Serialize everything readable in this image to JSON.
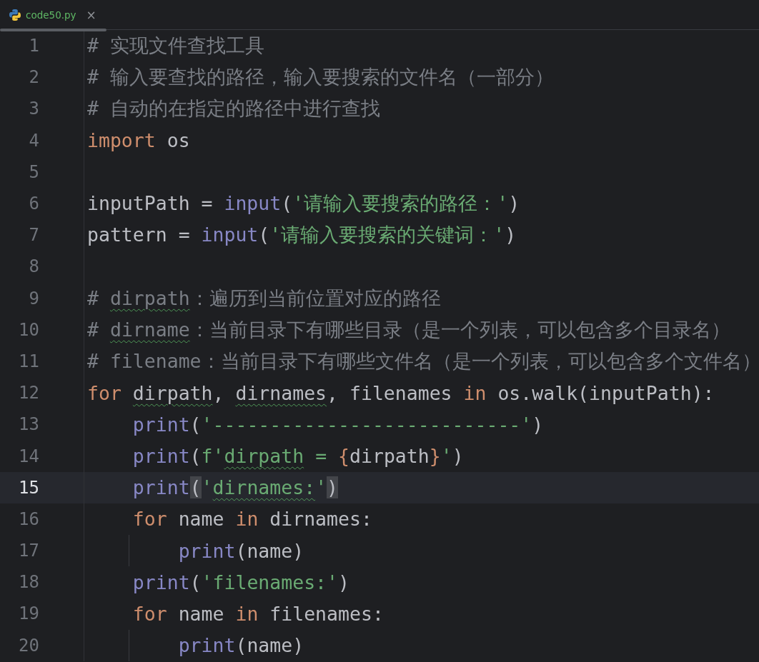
{
  "tab": {
    "label": "code50.py",
    "selected": true,
    "close": "×"
  },
  "lines": [
    {
      "number": "1",
      "current": false,
      "tokens": [
        {
          "kind": "comment",
          "text": "# 实现文件查找工具"
        }
      ]
    },
    {
      "number": "2",
      "current": false,
      "tokens": [
        {
          "kind": "comment",
          "text": "# 输入要查找的路径，输入要搜索的文件名（一部分）"
        }
      ]
    },
    {
      "number": "3",
      "current": false,
      "tokens": [
        {
          "kind": "comment",
          "text": "# 自动的在指定的路径中进行查找"
        }
      ]
    },
    {
      "number": "4",
      "current": false,
      "tokens": [
        {
          "kind": "keyword",
          "text": "import"
        },
        {
          "kind": "plain",
          "text": " os"
        }
      ]
    },
    {
      "number": "5",
      "current": false
    },
    {
      "number": "6",
      "current": false,
      "tokens": [
        {
          "kind": "plain",
          "text": "inputPath = "
        },
        {
          "kind": "builtin",
          "text": "input"
        },
        {
          "kind": "plain",
          "text": "("
        },
        {
          "kind": "string",
          "text": "'请输入要搜索的路径：'"
        },
        {
          "kind": "plain",
          "text": ")"
        }
      ]
    },
    {
      "number": "7",
      "current": false,
      "tokens": [
        {
          "kind": "plain",
          "text": "pattern = "
        },
        {
          "kind": "builtin",
          "text": "input"
        },
        {
          "kind": "plain",
          "text": "("
        },
        {
          "kind": "string",
          "text": "'请输入要搜索的关键词：'"
        },
        {
          "kind": "plain",
          "text": ")"
        }
      ]
    },
    {
      "number": "8",
      "current": false
    },
    {
      "number": "9",
      "current": false,
      "tokens": [
        {
          "kind": "comment",
          "text": "# "
        },
        {
          "kind": "comment-typo",
          "text": "dirpath"
        },
        {
          "kind": "comment",
          "text": "：遍历到当前位置对应的路径"
        }
      ]
    },
    {
      "number": "10",
      "current": false,
      "tokens": [
        {
          "kind": "comment",
          "text": "# "
        },
        {
          "kind": "comment-typo",
          "text": "dirname"
        },
        {
          "kind": "comment",
          "text": "：当前目录下有哪些目录（是一个列表，可以包含多个目录名）"
        }
      ]
    },
    {
      "number": "11",
      "current": false,
      "tokens": [
        {
          "kind": "comment",
          "text": "# filename：当前目录下有哪些文件名（是一个列表，可以包含多个文件名）"
        }
      ]
    },
    {
      "number": "12",
      "current": false,
      "tokens": [
        {
          "kind": "keyword",
          "text": "for "
        },
        {
          "kind": "plain-typo",
          "text": "dirpath"
        },
        {
          "kind": "plain",
          "text": ", "
        },
        {
          "kind": "plain-typo",
          "text": "dirnames"
        },
        {
          "kind": "plain",
          "text": ", filenames "
        },
        {
          "kind": "keyword",
          "text": "in"
        },
        {
          "kind": "plain",
          "text": " os.walk(inputPath):"
        }
      ]
    },
    {
      "number": "13",
      "current": false,
      "tokens": [
        {
          "kind": "builtin",
          "text": "    print"
        },
        {
          "kind": "plain",
          "text": "("
        },
        {
          "kind": "string",
          "text": "'---------------------------'"
        },
        {
          "kind": "plain",
          "text": ")"
        }
      ]
    },
    {
      "number": "14",
      "current": false,
      "tokens": [
        {
          "kind": "builtin",
          "text": "    print"
        },
        {
          "kind": "plain",
          "text": "("
        },
        {
          "kind": "string",
          "text": "f'"
        },
        {
          "kind": "string-typo",
          "text": "dirpath"
        },
        {
          "kind": "string",
          "text": " = "
        },
        {
          "kind": "fbrace",
          "text": "{"
        },
        {
          "kind": "plain",
          "text": "dirpath"
        },
        {
          "kind": "fbrace",
          "text": "}"
        },
        {
          "kind": "string",
          "text": "'"
        },
        {
          "kind": "plain",
          "text": ")"
        }
      ]
    },
    {
      "number": "15",
      "current": true,
      "tokens": [
        {
          "kind": "builtin",
          "text": "    print"
        },
        {
          "kind": "paren-match",
          "text": "("
        },
        {
          "kind": "string",
          "text": "'"
        },
        {
          "kind": "string-typo",
          "text": "dirnames:"
        },
        {
          "kind": "string",
          "text": "'"
        },
        {
          "kind": "paren-match",
          "text": ")"
        }
      ]
    },
    {
      "number": "16",
      "current": false,
      "tokens": [
        {
          "kind": "keyword",
          "text": "    for"
        },
        {
          "kind": "plain",
          "text": " name "
        },
        {
          "kind": "keyword",
          "text": "in"
        },
        {
          "kind": "plain",
          "text": " dirnames:"
        }
      ]
    },
    {
      "number": "17",
      "current": false,
      "tokens": [
        {
          "kind": "builtin",
          "text": "        print"
        },
        {
          "kind": "plain",
          "text": "(name)"
        }
      ]
    },
    {
      "number": "18",
      "current": false,
      "tokens": [
        {
          "kind": "builtin",
          "text": "    print"
        },
        {
          "kind": "plain",
          "text": "("
        },
        {
          "kind": "string",
          "text": "'filenames:'"
        },
        {
          "kind": "plain",
          "text": ")"
        }
      ]
    },
    {
      "number": "19",
      "current": false,
      "tokens": [
        {
          "kind": "keyword",
          "text": "    for"
        },
        {
          "kind": "plain",
          "text": " name "
        },
        {
          "kind": "keyword",
          "text": "in"
        },
        {
          "kind": "plain",
          "text": " filenames:"
        }
      ]
    },
    {
      "number": "20",
      "current": false,
      "tokens": [
        {
          "kind": "builtin",
          "text": "        print"
        },
        {
          "kind": "plain",
          "text": "(name)"
        }
      ]
    }
  ]
}
